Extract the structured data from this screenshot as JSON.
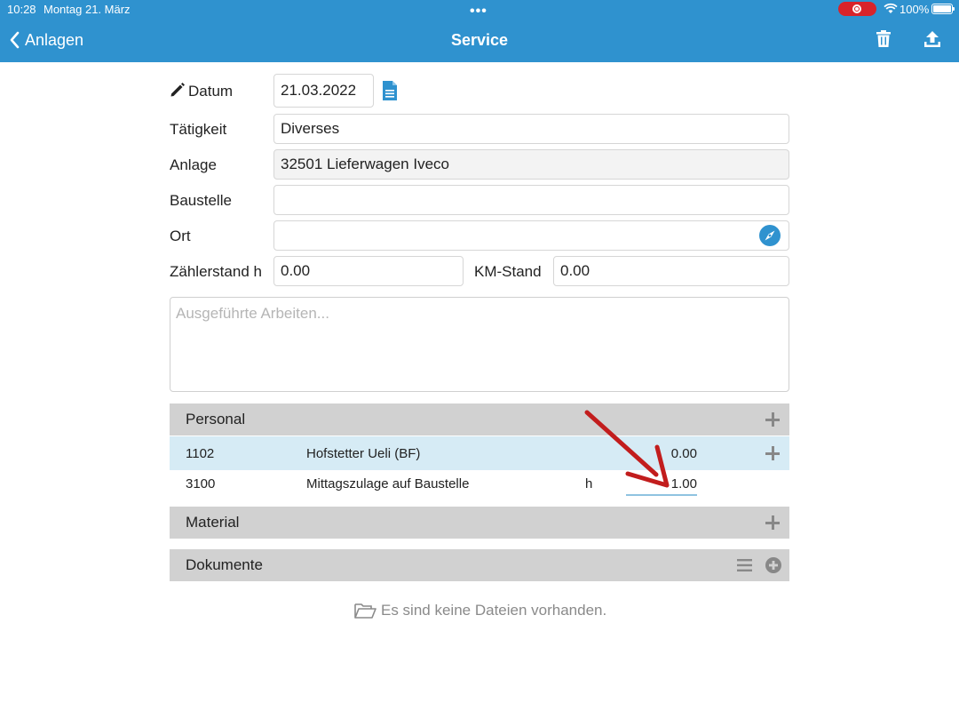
{
  "status_bar": {
    "time": "10:28",
    "date": "Montag 21. März",
    "dots": "•••",
    "battery": "100%"
  },
  "nav": {
    "back_label": "Anlagen",
    "title": "Service"
  },
  "form": {
    "datum_label": "Datum",
    "datum_value": "21.03.2022",
    "taetigkeit_label": "Tätigkeit",
    "taetigkeit_value": "Diverses",
    "anlage_label": "Anlage",
    "anlage_value": "32501 Lieferwagen Iveco",
    "baustelle_label": "Baustelle",
    "baustelle_value": "",
    "ort_label": "Ort",
    "ort_value": "",
    "zaehlerstand_label": "Zählerstand h",
    "zaehlerstand_value": "0.00",
    "km_label": "KM-Stand",
    "km_value": "0.00",
    "arbeiten_placeholder": "Ausgeführte Arbeiten..."
  },
  "personal": {
    "title": "Personal",
    "rows": [
      {
        "code": "1102",
        "name": "Hofstetter Ueli (BF)",
        "unit": "",
        "value": "0.00"
      },
      {
        "code": "3100",
        "name": "Mittagszulage auf Baustelle",
        "unit": "h",
        "value": "1.00"
      }
    ]
  },
  "material": {
    "title": "Material"
  },
  "dokumente": {
    "title": "Dokumente",
    "empty_message": "Es sind keine Dateien vorhanden."
  },
  "colors": {
    "header": "#2f92cf",
    "section": "#d1d1d1",
    "highlight_row": "#d6ebf5",
    "annotation_arrow": "#c21d1d"
  }
}
